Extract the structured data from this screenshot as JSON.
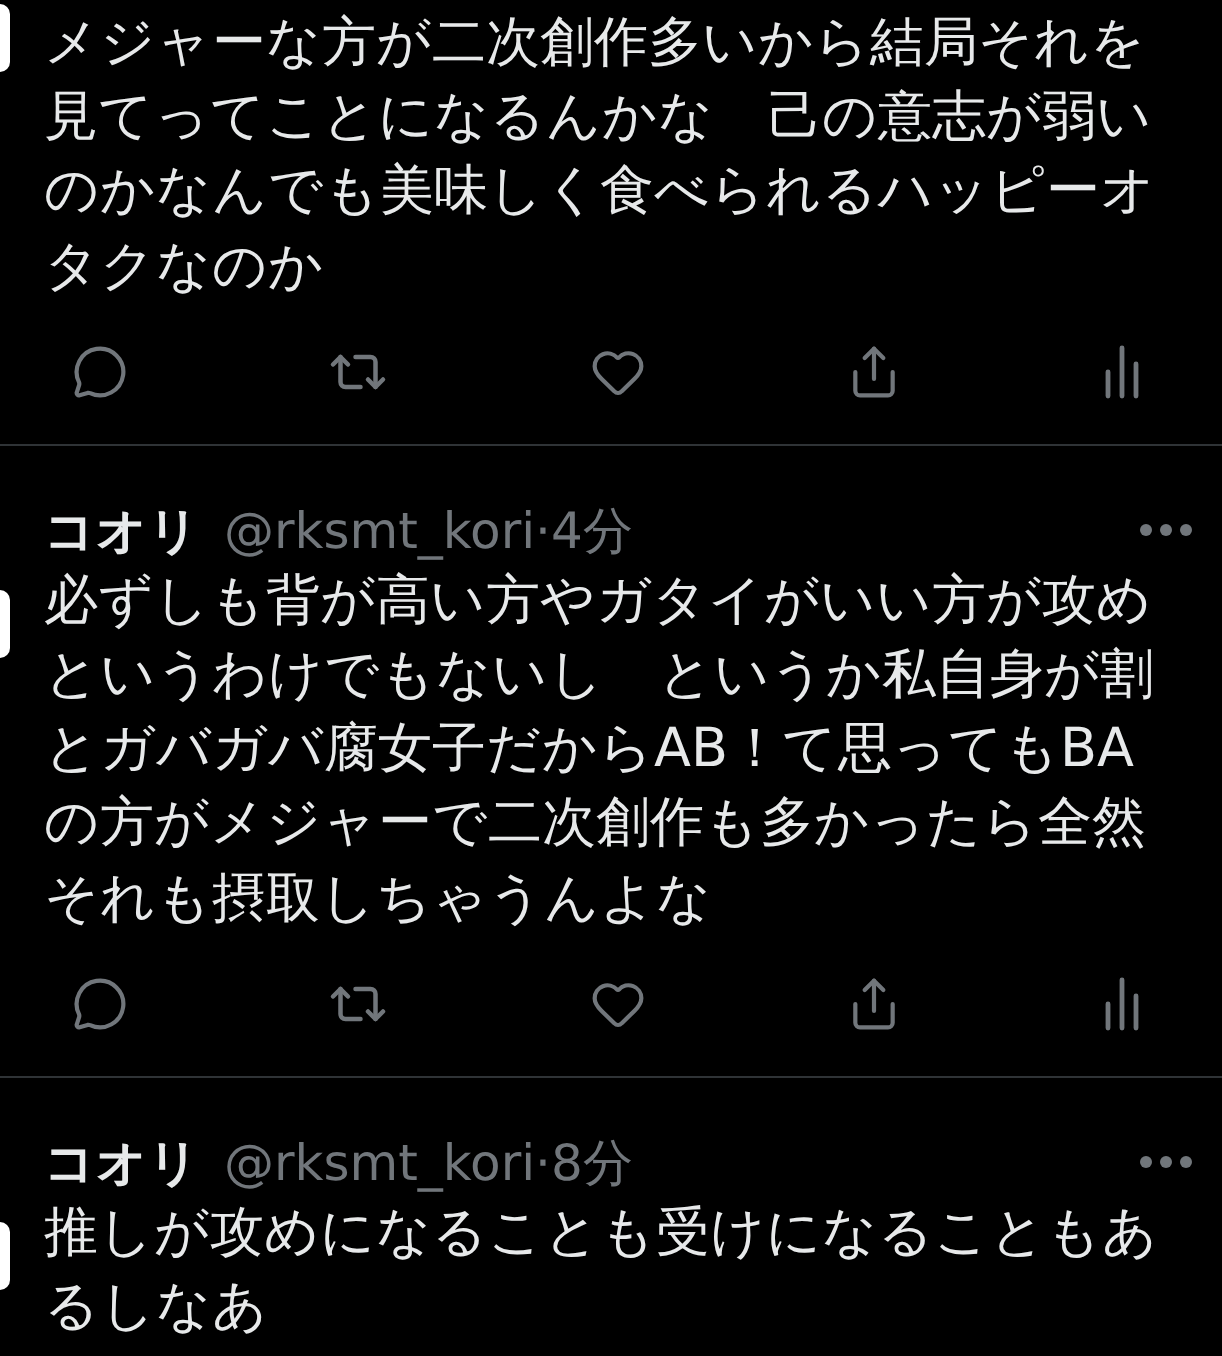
{
  "tweets": [
    {
      "text": "メジャーな方が二次創作多いから結局それを見てってことになるんかな　己の意志が弱いのかなんでも美味しく食べられるハッピーオタクなのか"
    },
    {
      "author": "コオリ",
      "meta": "@rksmt_kori·4分",
      "text": "必ずしも背が高い方やガタイがいい方が攻めというわけでもないし　というか私自身が割とガバガバ腐女子だからAB！て思ってもBAの方がメジャーで二次創作も多かったら全然それも摂取しちゃうんよな"
    },
    {
      "author": "コオリ",
      "meta": "@rksmt_kori·8分",
      "text": "推しが攻めになることも受けになることもあるしなあ"
    }
  ]
}
